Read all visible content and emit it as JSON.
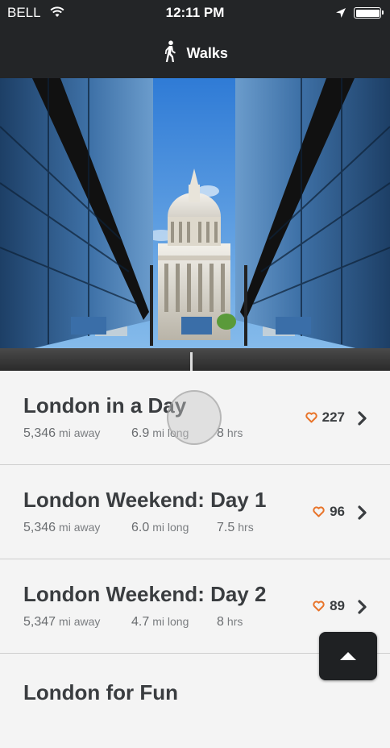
{
  "status_bar": {
    "carrier": "BELL",
    "time": "12:11 PM",
    "icons": [
      "wifi-icon",
      "location-arrow-icon",
      "battery-icon"
    ]
  },
  "nav": {
    "title": "Walks",
    "icon": "walking-person-icon"
  },
  "hero": {
    "icon": "photo-st-pauls-cathedral"
  },
  "walks": [
    {
      "name": "London in a Day",
      "distance_away": "5,346",
      "distance_away_unit": "mi away",
      "length": "6.9",
      "length_unit": "mi long",
      "duration": "8",
      "duration_unit": "hrs",
      "likes": "227"
    },
    {
      "name": "London Weekend: Day 1",
      "distance_away": "5,346",
      "distance_away_unit": "mi away",
      "length": "6.0",
      "length_unit": "mi long",
      "duration": "7.5",
      "duration_unit": "hrs",
      "likes": "96"
    },
    {
      "name": "London Weekend: Day 2",
      "distance_away": "5,347",
      "distance_away_unit": "mi away",
      "length": "4.7",
      "length_unit": "mi long",
      "duration": "8",
      "duration_unit": "hrs",
      "likes": "89"
    },
    {
      "name": "London for Fun"
    }
  ],
  "colors": {
    "bar": "#232527",
    "heart": "#e8742a",
    "title_text": "#3a3d40"
  }
}
